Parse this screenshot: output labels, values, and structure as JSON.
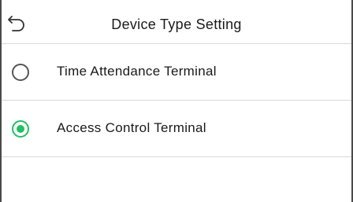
{
  "header": {
    "title": "Device Type Setting",
    "back_icon": "back-arrow-icon"
  },
  "options": [
    {
      "label": "Time Attendance Terminal",
      "selected": false
    },
    {
      "label": "Access Control Terminal",
      "selected": true
    }
  ],
  "colors": {
    "accent": "#22c063",
    "divider": "#d9d9d9",
    "radio_unchecked": "#555555"
  }
}
